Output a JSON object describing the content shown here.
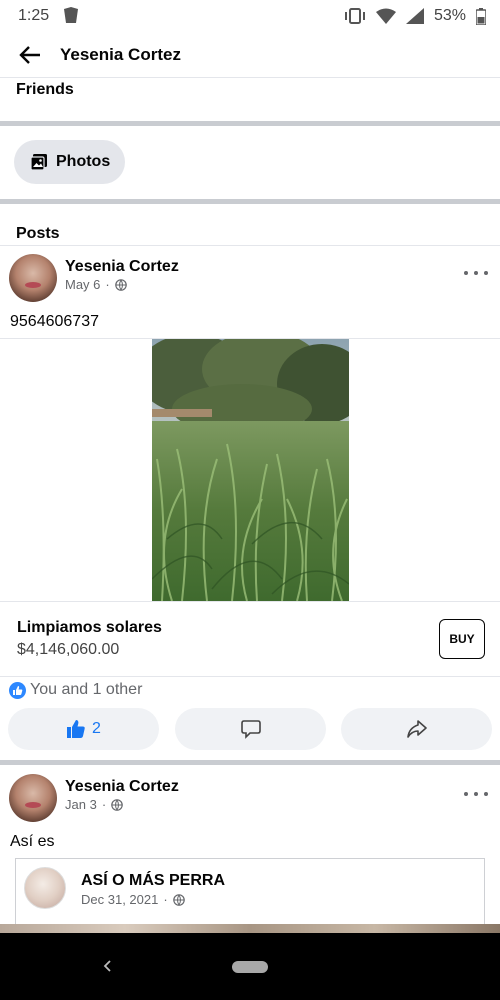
{
  "status_bar": {
    "time": "1:25",
    "battery": "53%"
  },
  "header": {
    "title": "Yesenia Cortez"
  },
  "sections": {
    "friends": "Friends",
    "photos": "Photos",
    "posts": "Posts"
  },
  "posts": [
    {
      "author": "Yesenia Cortez",
      "date": "May 6",
      "text": "9564606737",
      "listing": {
        "title": "Limpiamos solares",
        "price": "$4,146,060.00",
        "buy_label": "BUY"
      },
      "reactions": "You and 1 other",
      "like_count": "2"
    },
    {
      "author": "Yesenia Cortez",
      "date": "Jan 3",
      "text": "Así es",
      "shared": {
        "author": "ASÍ O MÁS PERRA",
        "date": "Dec 31, 2021"
      }
    }
  ],
  "icons": {
    "back": "arrow-left-icon",
    "photos": "photo-album-icon",
    "privacy": "globe-icon",
    "more": "more-horizontal-icon",
    "like": "thumbs-up-icon",
    "comment": "comment-icon",
    "share": "share-icon"
  },
  "colors": {
    "like_blue": "#2d88ff",
    "divider": "#c9ccd1",
    "button_bg": "#f0f2f5"
  }
}
